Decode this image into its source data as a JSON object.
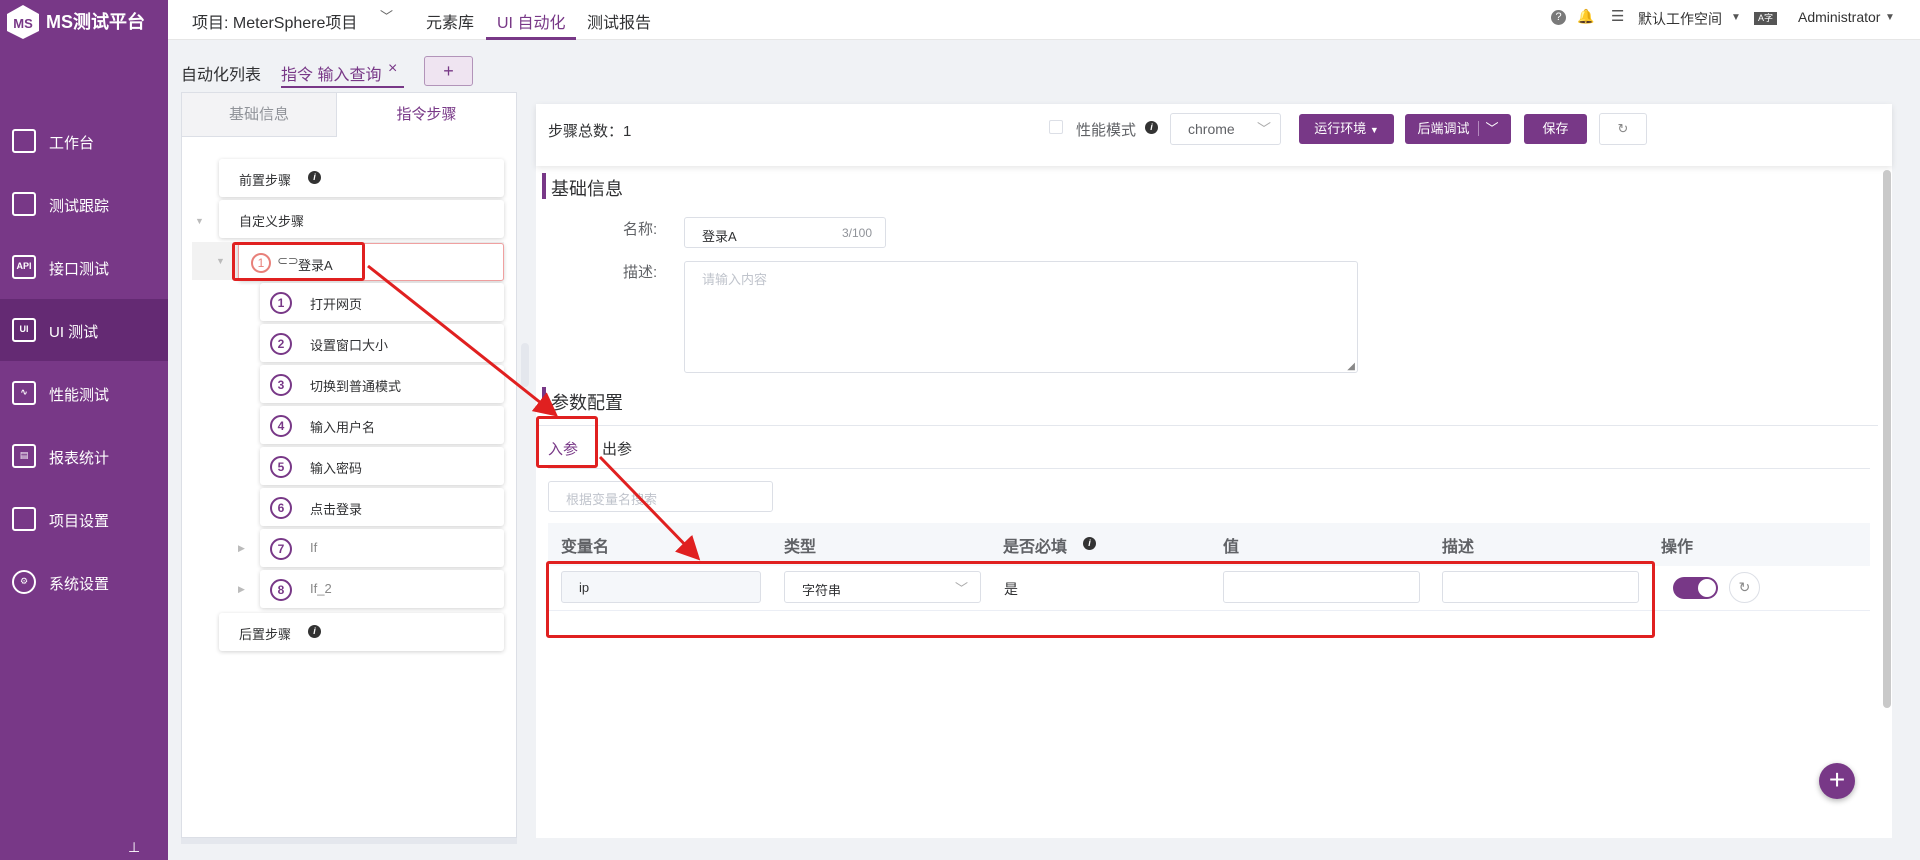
{
  "brand": "MS测试平台",
  "nav": [
    {
      "label": "工作台",
      "icon": "monitor-icon"
    },
    {
      "label": "测试跟踪",
      "icon": "clipboard-icon"
    },
    {
      "label": "接口测试",
      "icon": "api-icon"
    },
    {
      "label": "UI 测试",
      "icon": "ui-icon"
    },
    {
      "label": "性能测试",
      "icon": "chart-icon"
    },
    {
      "label": "报表统计",
      "icon": "report-icon"
    },
    {
      "label": "项目设置",
      "icon": "folder-icon"
    },
    {
      "label": "系统设置",
      "icon": "gear-icon"
    }
  ],
  "topbar": {
    "project": "项目: MeterSphere项目",
    "tabs": [
      "元素库",
      "UI 自动化",
      "测试报告"
    ],
    "workspace": "默认工作空间",
    "user": "Administrator",
    "lang_icon": "A字"
  },
  "tabs": {
    "list": "自动化列表",
    "active": "指令 输入查询",
    "close": "×",
    "add": "+"
  },
  "left": {
    "tab_basic": "基础信息",
    "tab_steps": "指令步骤",
    "pre": "前置步骤",
    "custom": "自定义步骤",
    "group_num": "1",
    "group_name": "登录A",
    "post": "后置步骤",
    "steps": [
      {
        "n": "1",
        "name": "打开网页"
      },
      {
        "n": "2",
        "name": "设置窗口大小"
      },
      {
        "n": "3",
        "name": "切换到普通模式"
      },
      {
        "n": "4",
        "name": "输入用户名"
      },
      {
        "n": "5",
        "name": "输入密码"
      },
      {
        "n": "6",
        "name": "点击登录"
      },
      {
        "n": "7",
        "name": "If"
      },
      {
        "n": "8",
        "name": "If_2"
      }
    ]
  },
  "toolbar": {
    "total": "步骤总数：1",
    "perf": "性能模式",
    "browser": "chrome",
    "env": "运行环境",
    "debug": "后端调试",
    "save": "保存"
  },
  "basic": {
    "title": "基础信息",
    "name_label": "名称:",
    "name_value": "登录A",
    "name_count": "3/100",
    "desc_label": "描述:",
    "desc_ph": "请输入内容"
  },
  "params": {
    "title": "参数配置",
    "tab_in": "入参",
    "tab_out": "出参",
    "search_ph": "根据变量名搜索",
    "headers": [
      "变量名",
      "类型",
      "是否必填",
      "值",
      "描述",
      "操作"
    ],
    "row": {
      "name": "ip",
      "type": "字符串",
      "required": "是",
      "value": "",
      "desc": ""
    }
  },
  "fab": "+",
  "colors": {
    "primary": "#783887",
    "annotation": "#e02020"
  }
}
